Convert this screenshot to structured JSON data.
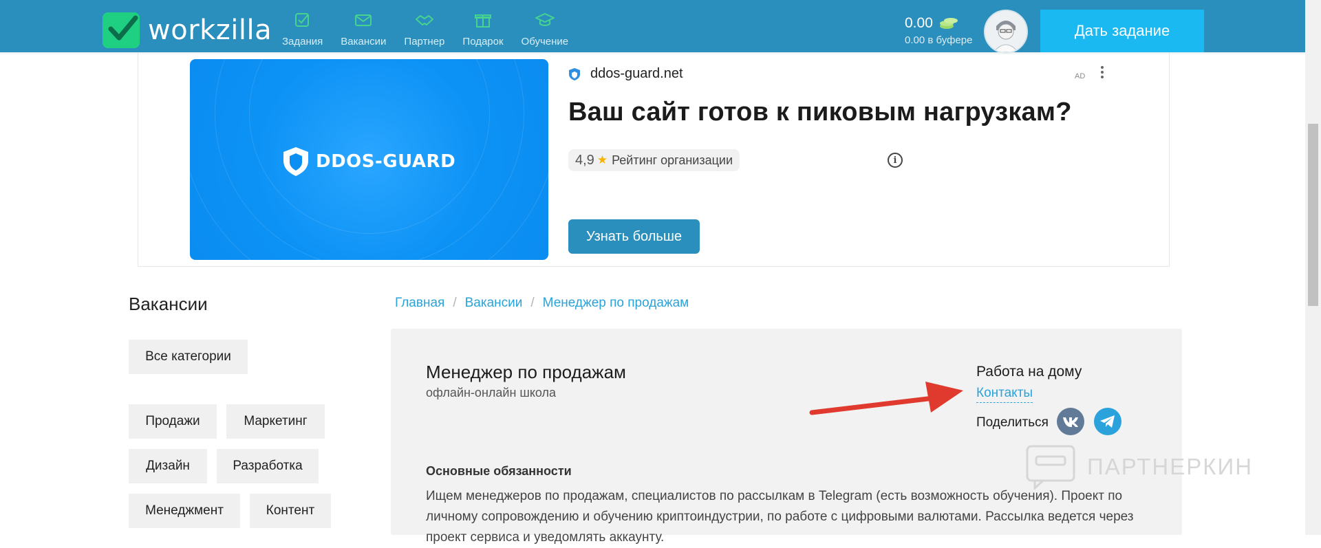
{
  "header": {
    "logo_text": "workzilla",
    "nav": [
      {
        "label": "Задания",
        "icon": "tasks-icon"
      },
      {
        "label": "Вакансии",
        "icon": "vacancies-icon"
      },
      {
        "label": "Партнер",
        "icon": "partner-icon"
      },
      {
        "label": "Подарок",
        "icon": "gift-icon"
      },
      {
        "label": "Обучение",
        "icon": "education-icon"
      }
    ],
    "balance": "0.00",
    "buffer": "0.00 в буфере",
    "give_task_label": "Дать задание"
  },
  "ad": {
    "banner_brand": "DDOS-GUARD",
    "domain": "ddos-guard.net",
    "badge": "AD",
    "headline": "Ваш сайт готов к пиковым нагрузкам?",
    "rating_value": "4,9",
    "rating_label": "Рейтинг организации",
    "info_symbol": "i",
    "cta_label": "Узнать больше"
  },
  "sidebar": {
    "title": "Вакансии",
    "categories": [
      "Все категории",
      "Продажи",
      "Маркетинг",
      "Дизайн",
      "Разработка",
      "Менеджмент",
      "Контент"
    ]
  },
  "breadcrumb": [
    "Главная",
    "Вакансии",
    "Менеджер по продажам"
  ],
  "breadcrumb_separator": "/",
  "job": {
    "title": "Менеджер по продажам",
    "company": "офлайн-онлайн школа",
    "work_type": "Работа на дому",
    "contacts_label": "Контакты",
    "share_label": "Поделиться",
    "duties_title": "Основные обязанности",
    "duties_text": "Ищем менеджеров по продажам, специалистов по рассылкам в Telegram (есть возможность обучения). Проект по личному сопровождению и обучению криптоиндустрии, по работе с цифровыми валютами. Рассылка ведется через проект сервиса и уведомлять аккаунту."
  },
  "watermark": "ПАРТНЕРКИН",
  "colors": {
    "header": "#2a8fbc",
    "cta": "#1bb9f1",
    "link": "#29a3d9",
    "arrow": "#e03a2f"
  }
}
